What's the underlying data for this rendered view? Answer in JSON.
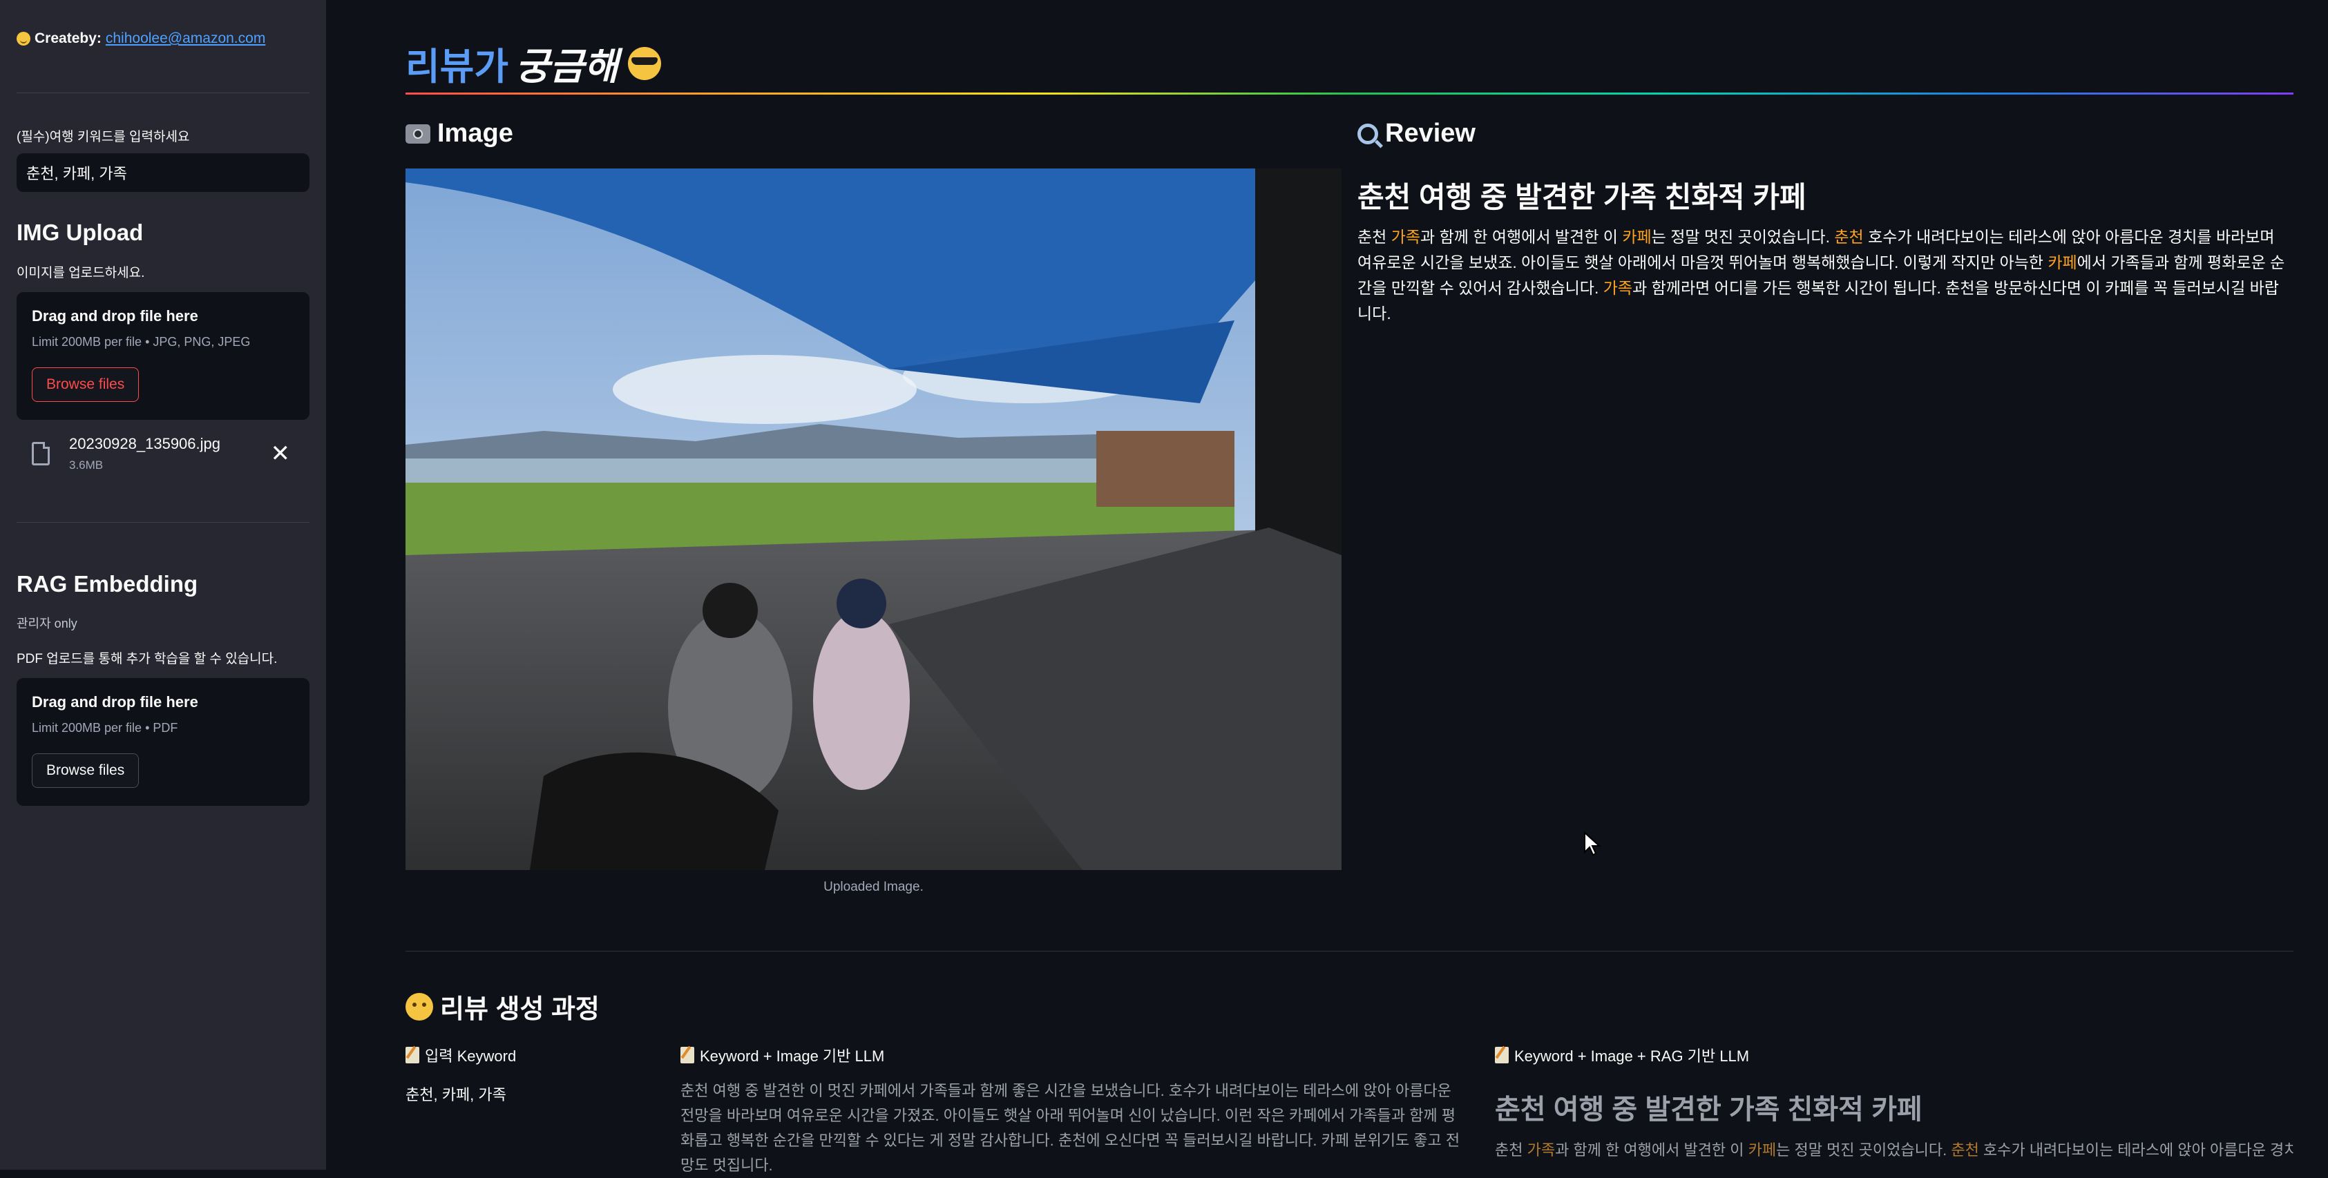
{
  "sidebar": {
    "createby_label": "Createby:",
    "createby_email": "chihoolee@amazon.com",
    "keyword_label": "(필수)여행 키워드를 입력하세요",
    "keyword_value": "춘천, 카페, 가족",
    "img_upload": {
      "title": "IMG Upload",
      "instruction": "이미지를 업로드하세요.",
      "drop_title": "Drag and drop file here",
      "limit": "Limit 200MB per file • JPG, PNG, JPEG",
      "browse_label": "Browse files",
      "file_name": "20230928_135906.jpg",
      "file_size": "3.6MB"
    },
    "rag": {
      "title": "RAG Embedding",
      "admin_note": "관리자 only",
      "instruction": "PDF 업로드를 통해 추가 학습을 할 수 있습니다.",
      "drop_title": "Drag and drop file here",
      "limit": "Limit 200MB per file • PDF",
      "browse_label": "Browse files"
    }
  },
  "main": {
    "title_part1": "리뷰가",
    "title_part2": "궁금해",
    "image_header": "Image",
    "review_header": "Review",
    "image_caption": "Uploaded Image.",
    "review": {
      "title": "춘천 여행 중 발견한 가족 친화적 카페",
      "segments": [
        {
          "text": "춘천 ",
          "hl": false
        },
        {
          "text": "가족",
          "hl": true
        },
        {
          "text": "과 함께 한 여행에서 발견한 이 ",
          "hl": false
        },
        {
          "text": "카페",
          "hl": true
        },
        {
          "text": "는 정말 멋진 곳이었습니다. ",
          "hl": false
        },
        {
          "text": "춘천",
          "hl": true
        },
        {
          "text": " 호수가 내려다보이는 테라스에 앉아 아름다운 경치를 바라보며 여유로운 시간을 보냈죠. 아이들도 햇살 아래에서 마음껏 뛰어놀며 행복해했습니다. 이렇게 작지만 아늑한 ",
          "hl": false
        },
        {
          "text": "카페",
          "hl": true
        },
        {
          "text": "에서 가족들과 함께 평화로운 순간을 만끽할 수 있어서 감사했습니다. ",
          "hl": false
        },
        {
          "text": "가족",
          "hl": true
        },
        {
          "text": "과 함께라면 어디를 가든 행복한 시간이 됩니다. 춘천을 방문하신다면 이 카페를 꼭 들러보시길 바랍니다.",
          "hl": false
        }
      ]
    },
    "process": {
      "title": "리뷰 생성 과정",
      "col1_header": "입력 Keyword",
      "col1_value": "춘천, 카페, 가족",
      "col2_header": "Keyword + Image 기반 LLM",
      "col2_body": "춘천 여행 중 발견한 이 멋진 카페에서 가족들과 함께 좋은 시간을 보냈습니다. 호수가 내려다보이는 테라스에 앉아 아름다운 전망을 바라보며 여유로운 시간을 가졌죠. 아이들도 햇살 아래 뛰어놀며 신이 났습니다. 이런 작은 카페에서 가족들과 함께 평화롭고 행복한 순간을 만끽할 수 있다는 게 정말 감사합니다. 춘천에 오신다면 꼭 들러보시길 바랍니다. 카페 분위기도 좋고 전망도 멋집니다.",
      "col3_header": "Keyword + Image + RAG 기반 LLM",
      "col3_title": "춘천 여행 중 발견한 가족 친화적 카페",
      "col3_segments": [
        {
          "text": "춘천 ",
          "hl": false
        },
        {
          "text": "가족",
          "hl": true
        },
        {
          "text": "과 함께 한 여행에서 발견한 이 ",
          "hl": false
        },
        {
          "text": "카페",
          "hl": true
        },
        {
          "text": "는 정말 멋진 곳이었습니다. ",
          "hl": false
        },
        {
          "text": "춘천",
          "hl": true
        },
        {
          "text": " 호수가 내려다보이는 테라스에 앉아 아름다운 경치를",
          "hl": false
        }
      ]
    }
  },
  "colors": {
    "background": "#0e1117",
    "sidebar": "#262730",
    "accent_red": "#ff4b4b",
    "highlight": "#ffa421",
    "title_blue": "#5b9cf6"
  }
}
